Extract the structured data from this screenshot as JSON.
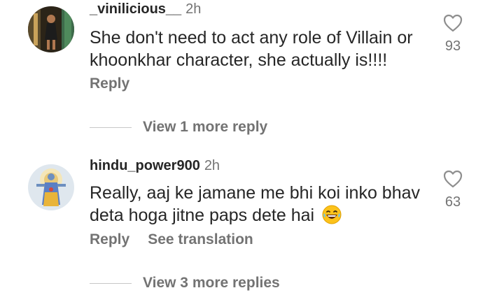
{
  "comments": [
    {
      "username": "_vinilicious__",
      "time": "2h",
      "text": "She don't need to act any role of Villain or khoonkhar character, she actually is!!!!",
      "likes": "93",
      "reply_label": "Reply",
      "view_replies": "View 1 more reply"
    },
    {
      "username": "hindu_power900",
      "time": "2h",
      "text": "Really, aaj ke jamane me bhi koi inko bhav deta hoga jitne paps dete hai",
      "emoji": "laughing-with-tears-emoji",
      "likes": "63",
      "reply_label": "Reply",
      "translation_label": "See translation",
      "view_replies": "View 3 more replies"
    }
  ],
  "colors": {
    "text": "#262626",
    "secondary": "#737373",
    "divider": "#c7c7c7"
  }
}
